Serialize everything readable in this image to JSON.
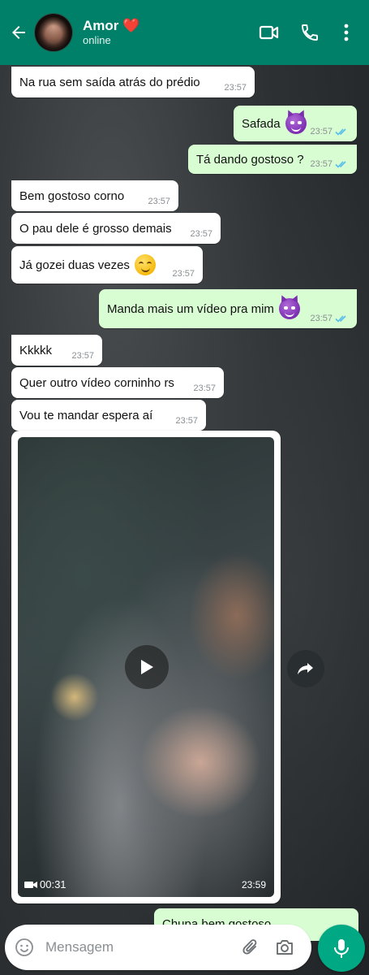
{
  "header": {
    "contact_name": "Amor",
    "contact_heart": "❤️",
    "status": "online",
    "icons": [
      "back-arrow-icon",
      "video-call-icon",
      "phone-icon",
      "more-vertical-icon"
    ],
    "color": "#008069"
  },
  "messages": [
    {
      "direction": "in",
      "text": "Na rua sem saída atrás do prédio",
      "time": "23:57"
    },
    {
      "direction": "out",
      "text": "Safada",
      "emoji": "smiling-devil",
      "time": "23:57",
      "read": true
    },
    {
      "direction": "out",
      "text": "Tá dando gostoso ?",
      "time": "23:57",
      "read": true
    },
    {
      "direction": "in",
      "text": "Bem gostoso corno",
      "time": "23:57"
    },
    {
      "direction": "in",
      "text": "O pau dele é grosso demais",
      "time": "23:57"
    },
    {
      "direction": "in",
      "text": "Já gozei duas vezes",
      "emoji": "smirking-face",
      "time": "23:57"
    },
    {
      "direction": "out",
      "text": "Manda mais um vídeo pra mim",
      "emoji": "smiling-devil",
      "time": "23:57",
      "read": true
    },
    {
      "direction": "in",
      "text": "Kkkkk",
      "time": "23:57"
    },
    {
      "direction": "in",
      "text": "Quer outro vídeo corninho rs",
      "time": "23:57"
    },
    {
      "direction": "in",
      "text": "Vou te mandar espera aí",
      "time": "23:57"
    }
  ],
  "video": {
    "duration": "00:31",
    "time": "23:59"
  },
  "partial_message": {
    "text": "Chupa bem gostoso"
  },
  "composer": {
    "placeholder": "Mensagem"
  },
  "colors": {
    "incoming": "#ffffff",
    "outgoing": "#d9fdd3",
    "read_ticks": "#53bdeb",
    "mic": "#00a884"
  }
}
